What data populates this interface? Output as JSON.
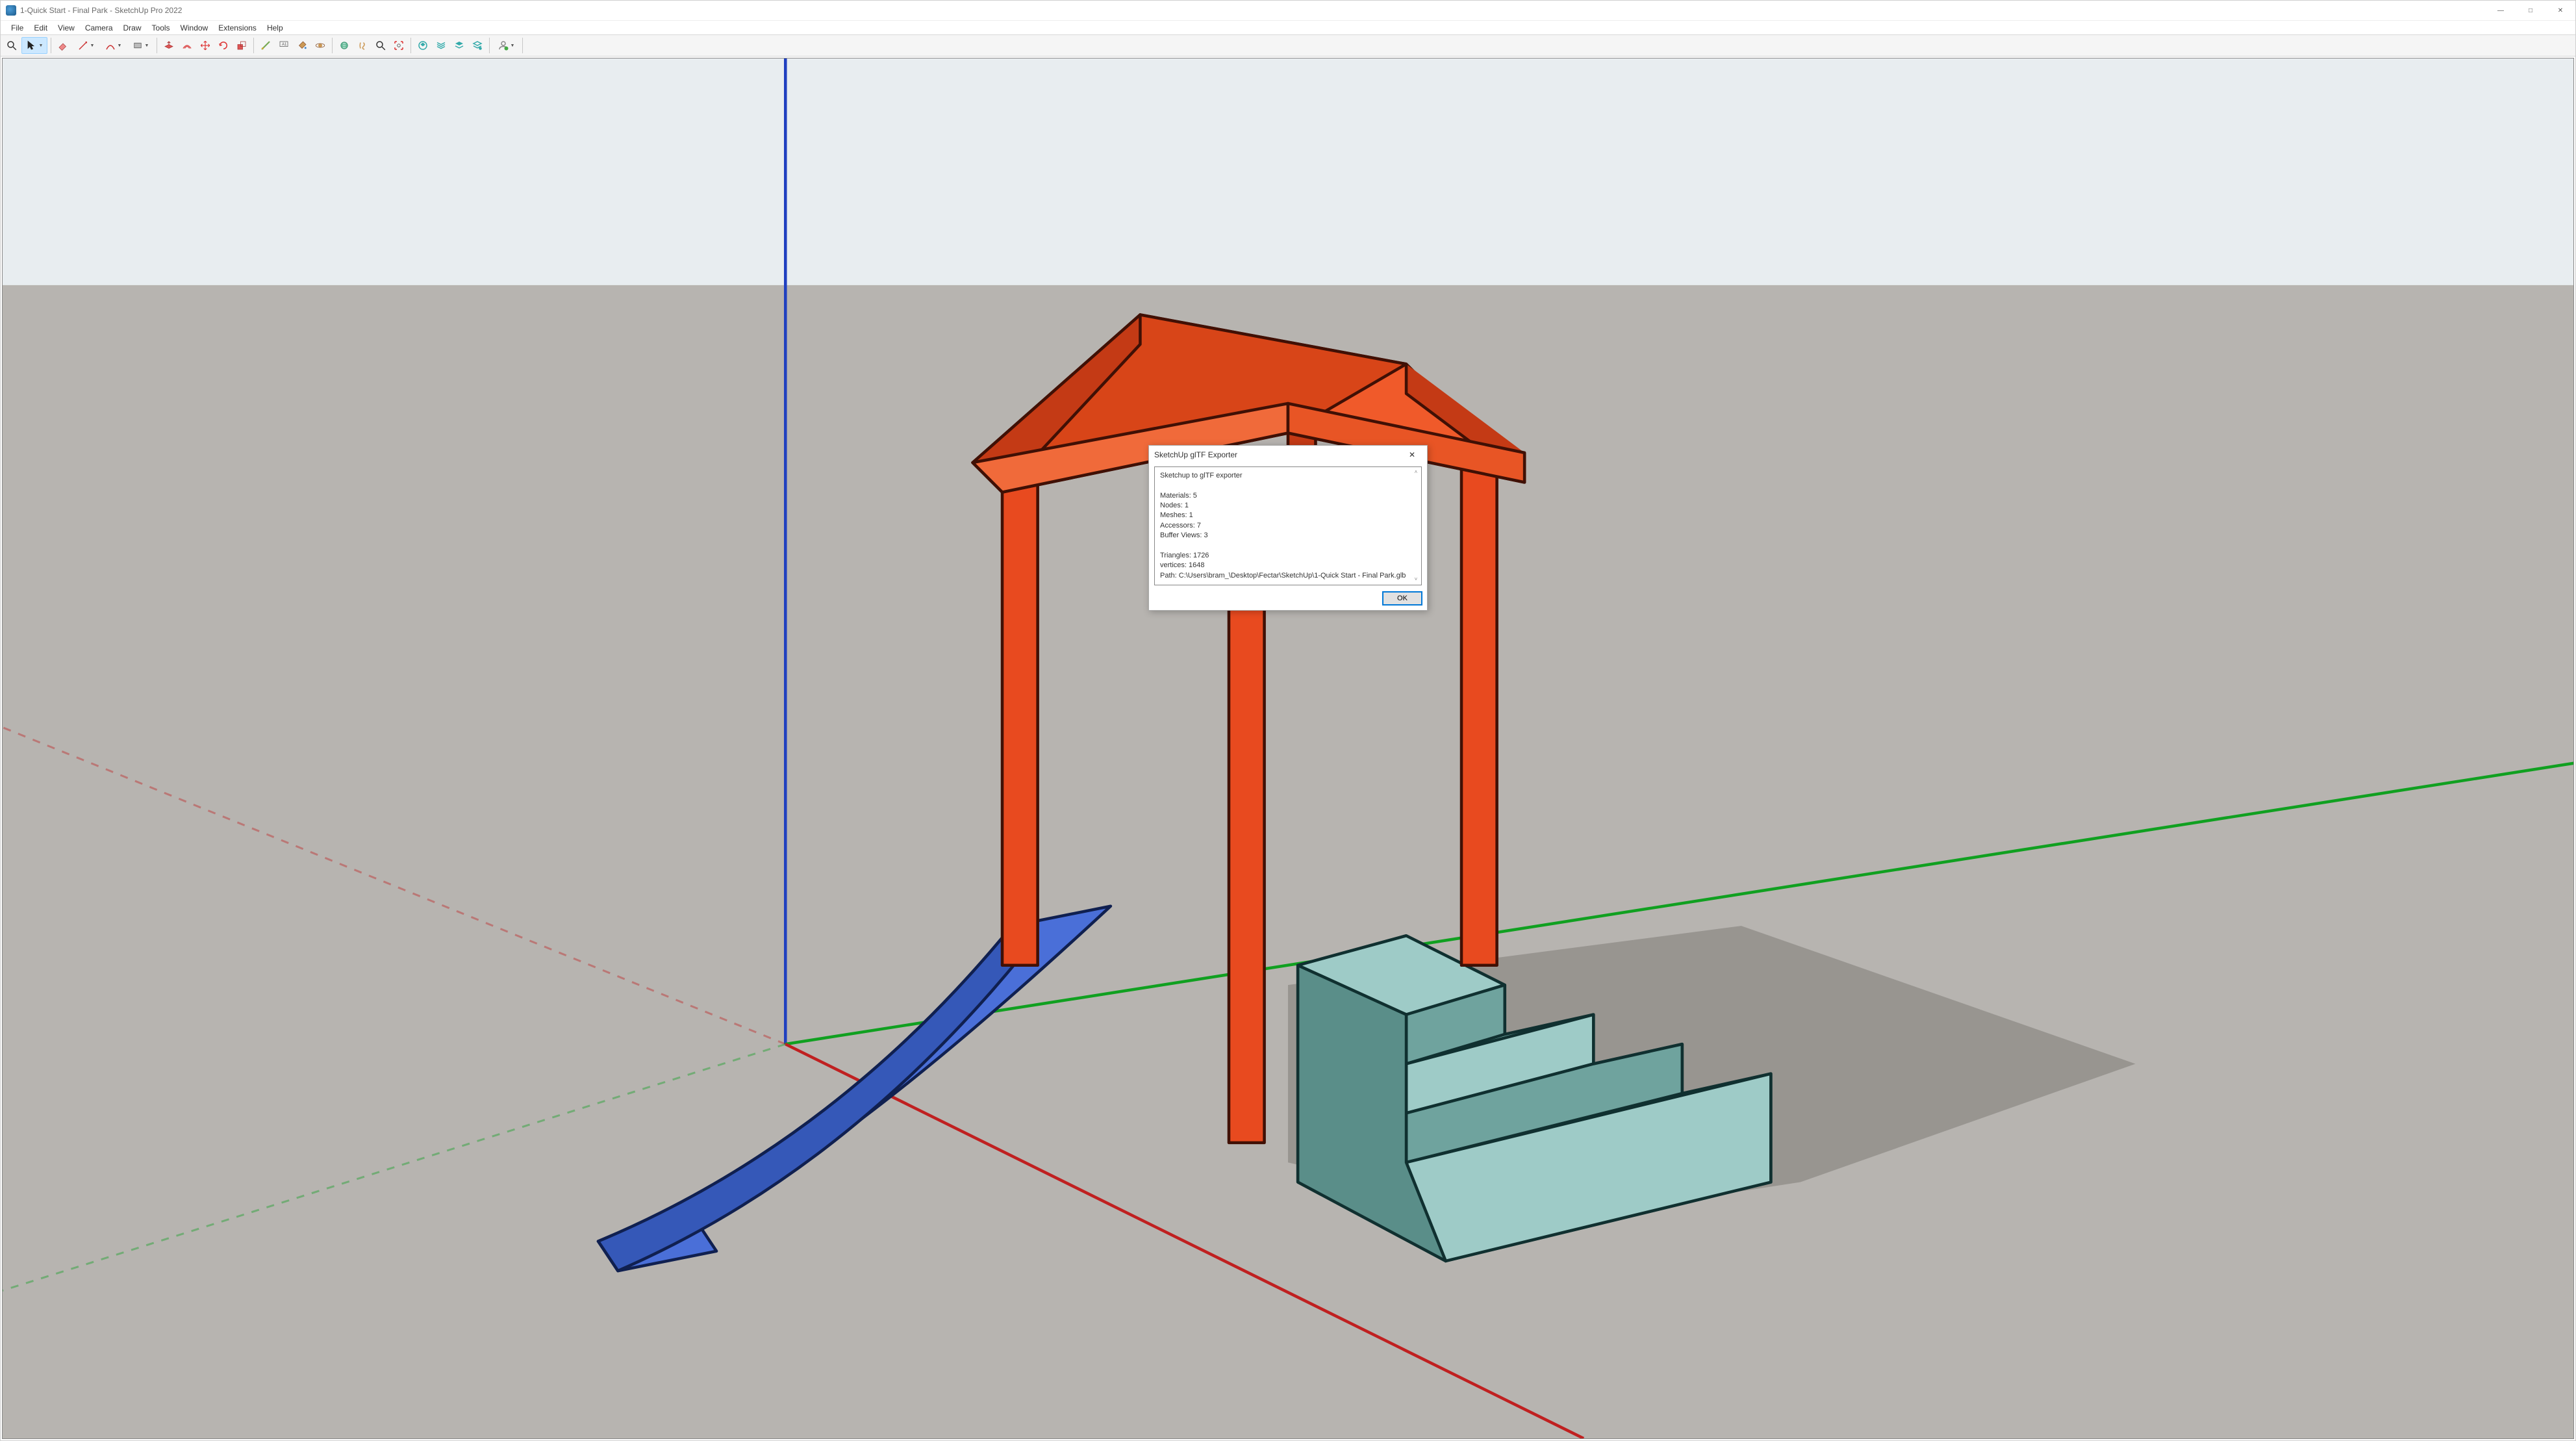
{
  "window": {
    "title": "1-Quick Start - Final Park - SketchUp Pro 2022"
  },
  "window_controls": {
    "minimize": "—",
    "maximize": "□",
    "close": "✕"
  },
  "menubar": [
    "File",
    "Edit",
    "View",
    "Camera",
    "Draw",
    "Tools",
    "Window",
    "Extensions",
    "Help"
  ],
  "dialog": {
    "title": "SketchUp glTF Exporter",
    "close": "✕",
    "body": {
      "header": "Sketchup to glTF exporter",
      "materials_label": "Materials:",
      "materials": "5",
      "nodes_label": "Nodes:",
      "nodes": "1",
      "meshes_label": "Meshes:",
      "meshes": "1",
      "accessors_label": "Accessors:",
      "accessors": "7",
      "bufferviews_label": "Buffer Views:",
      "bufferviews": "3",
      "triangles_label": "Triangles:",
      "triangles": "1726",
      "vertices_label": "vertices:",
      "vertices": "1648",
      "path_label": "Path:",
      "path": "C:\\Users\\bram_\\Desktop\\Fectar\\SketchUp\\1-Quick Start - Final Park.glb"
    },
    "ok": "OK"
  },
  "toolbar_groups": [
    [
      {
        "name": "search-icon",
        "dropdown": false
      },
      {
        "name": "select-tool-icon",
        "dropdown": true,
        "active": true
      }
    ],
    [
      {
        "name": "eraser-tool-icon",
        "dropdown": false
      },
      {
        "name": "line-tool-icon",
        "dropdown": true
      },
      {
        "name": "arc-tool-icon",
        "dropdown": true
      },
      {
        "name": "rectangle-tool-icon",
        "dropdown": true
      }
    ],
    [
      {
        "name": "pushpull-tool-icon",
        "dropdown": false
      },
      {
        "name": "offset-tool-icon",
        "dropdown": false
      },
      {
        "name": "move-tool-icon",
        "dropdown": false
      },
      {
        "name": "rotate-tool-icon",
        "dropdown": false
      },
      {
        "name": "scale-tool-icon",
        "dropdown": false
      }
    ],
    [
      {
        "name": "tape-measure-tool-icon",
        "dropdown": false
      },
      {
        "name": "text-tool-icon",
        "dropdown": false
      },
      {
        "name": "paint-bucket-tool-icon",
        "dropdown": false
      },
      {
        "name": "orbit-tool-icon",
        "dropdown": false
      }
    ],
    [
      {
        "name": "pan-tool-icon",
        "dropdown": false
      },
      {
        "name": "walk-tool-icon",
        "dropdown": false
      },
      {
        "name": "zoom-tool-icon",
        "dropdown": false
      },
      {
        "name": "zoom-extents-tool-icon",
        "dropdown": false
      }
    ],
    [
      {
        "name": "warehouse-icon",
        "dropdown": false
      },
      {
        "name": "extension-warehouse-icon",
        "dropdown": false
      },
      {
        "name": "layers-icon",
        "dropdown": false
      },
      {
        "name": "outliner-icon",
        "dropdown": false
      }
    ],
    [
      {
        "name": "user-icon",
        "dropdown": true
      }
    ]
  ]
}
